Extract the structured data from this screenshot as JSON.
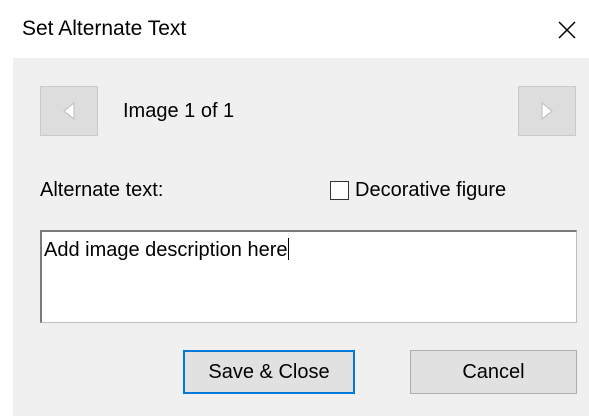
{
  "dialog": {
    "title": "Set Alternate Text",
    "close_icon": "close-icon"
  },
  "navigator": {
    "prev_icon": "triangle-left-icon",
    "next_icon": "triangle-right-icon",
    "counter": "Image 1 of 1"
  },
  "alt_text": {
    "label": "Alternate text:",
    "value": "Add image description here"
  },
  "decorative": {
    "label": "Decorative figure",
    "checked": false
  },
  "buttons": {
    "save_label": "Save & Close",
    "cancel_label": "Cancel"
  },
  "colors": {
    "panel_bg": "#f0f0f0",
    "focus_border": "#0078d7",
    "button_bg": "#e1e1e1"
  }
}
